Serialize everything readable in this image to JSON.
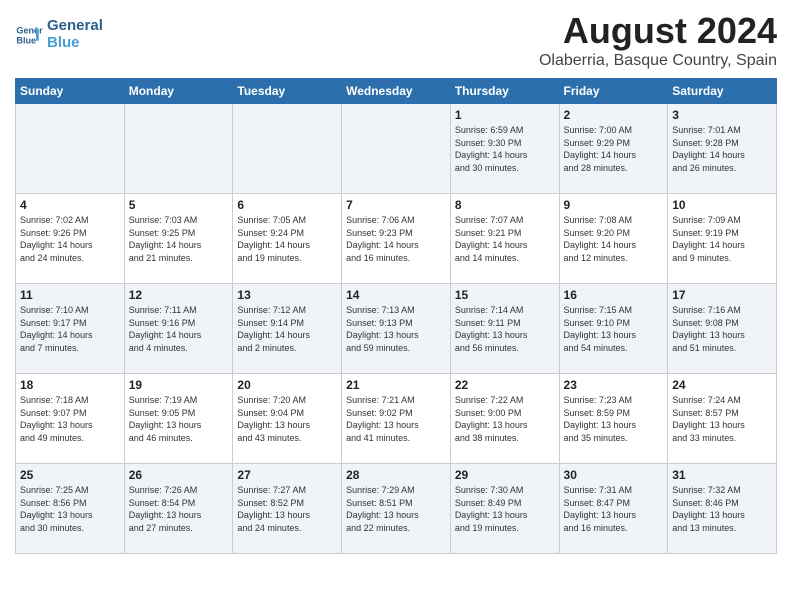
{
  "logo": {
    "line1": "General",
    "line2": "Blue"
  },
  "title": "August 2024",
  "subtitle": "Olaberria, Basque Country, Spain",
  "days_of_week": [
    "Sunday",
    "Monday",
    "Tuesday",
    "Wednesday",
    "Thursday",
    "Friday",
    "Saturday"
  ],
  "weeks": [
    [
      {
        "day": "",
        "info": ""
      },
      {
        "day": "",
        "info": ""
      },
      {
        "day": "",
        "info": ""
      },
      {
        "day": "",
        "info": ""
      },
      {
        "day": "1",
        "info": "Sunrise: 6:59 AM\nSunset: 9:30 PM\nDaylight: 14 hours\nand 30 minutes."
      },
      {
        "day": "2",
        "info": "Sunrise: 7:00 AM\nSunset: 9:29 PM\nDaylight: 14 hours\nand 28 minutes."
      },
      {
        "day": "3",
        "info": "Sunrise: 7:01 AM\nSunset: 9:28 PM\nDaylight: 14 hours\nand 26 minutes."
      }
    ],
    [
      {
        "day": "4",
        "info": "Sunrise: 7:02 AM\nSunset: 9:26 PM\nDaylight: 14 hours\nand 24 minutes."
      },
      {
        "day": "5",
        "info": "Sunrise: 7:03 AM\nSunset: 9:25 PM\nDaylight: 14 hours\nand 21 minutes."
      },
      {
        "day": "6",
        "info": "Sunrise: 7:05 AM\nSunset: 9:24 PM\nDaylight: 14 hours\nand 19 minutes."
      },
      {
        "day": "7",
        "info": "Sunrise: 7:06 AM\nSunset: 9:23 PM\nDaylight: 14 hours\nand 16 minutes."
      },
      {
        "day": "8",
        "info": "Sunrise: 7:07 AM\nSunset: 9:21 PM\nDaylight: 14 hours\nand 14 minutes."
      },
      {
        "day": "9",
        "info": "Sunrise: 7:08 AM\nSunset: 9:20 PM\nDaylight: 14 hours\nand 12 minutes."
      },
      {
        "day": "10",
        "info": "Sunrise: 7:09 AM\nSunset: 9:19 PM\nDaylight: 14 hours\nand 9 minutes."
      }
    ],
    [
      {
        "day": "11",
        "info": "Sunrise: 7:10 AM\nSunset: 9:17 PM\nDaylight: 14 hours\nand 7 minutes."
      },
      {
        "day": "12",
        "info": "Sunrise: 7:11 AM\nSunset: 9:16 PM\nDaylight: 14 hours\nand 4 minutes."
      },
      {
        "day": "13",
        "info": "Sunrise: 7:12 AM\nSunset: 9:14 PM\nDaylight: 14 hours\nand 2 minutes."
      },
      {
        "day": "14",
        "info": "Sunrise: 7:13 AM\nSunset: 9:13 PM\nDaylight: 13 hours\nand 59 minutes."
      },
      {
        "day": "15",
        "info": "Sunrise: 7:14 AM\nSunset: 9:11 PM\nDaylight: 13 hours\nand 56 minutes."
      },
      {
        "day": "16",
        "info": "Sunrise: 7:15 AM\nSunset: 9:10 PM\nDaylight: 13 hours\nand 54 minutes."
      },
      {
        "day": "17",
        "info": "Sunrise: 7:16 AM\nSunset: 9:08 PM\nDaylight: 13 hours\nand 51 minutes."
      }
    ],
    [
      {
        "day": "18",
        "info": "Sunrise: 7:18 AM\nSunset: 9:07 PM\nDaylight: 13 hours\nand 49 minutes."
      },
      {
        "day": "19",
        "info": "Sunrise: 7:19 AM\nSunset: 9:05 PM\nDaylight: 13 hours\nand 46 minutes."
      },
      {
        "day": "20",
        "info": "Sunrise: 7:20 AM\nSunset: 9:04 PM\nDaylight: 13 hours\nand 43 minutes."
      },
      {
        "day": "21",
        "info": "Sunrise: 7:21 AM\nSunset: 9:02 PM\nDaylight: 13 hours\nand 41 minutes."
      },
      {
        "day": "22",
        "info": "Sunrise: 7:22 AM\nSunset: 9:00 PM\nDaylight: 13 hours\nand 38 minutes."
      },
      {
        "day": "23",
        "info": "Sunrise: 7:23 AM\nSunset: 8:59 PM\nDaylight: 13 hours\nand 35 minutes."
      },
      {
        "day": "24",
        "info": "Sunrise: 7:24 AM\nSunset: 8:57 PM\nDaylight: 13 hours\nand 33 minutes."
      }
    ],
    [
      {
        "day": "25",
        "info": "Sunrise: 7:25 AM\nSunset: 8:56 PM\nDaylight: 13 hours\nand 30 minutes."
      },
      {
        "day": "26",
        "info": "Sunrise: 7:26 AM\nSunset: 8:54 PM\nDaylight: 13 hours\nand 27 minutes."
      },
      {
        "day": "27",
        "info": "Sunrise: 7:27 AM\nSunset: 8:52 PM\nDaylight: 13 hours\nand 24 minutes."
      },
      {
        "day": "28",
        "info": "Sunrise: 7:29 AM\nSunset: 8:51 PM\nDaylight: 13 hours\nand 22 minutes."
      },
      {
        "day": "29",
        "info": "Sunrise: 7:30 AM\nSunset: 8:49 PM\nDaylight: 13 hours\nand 19 minutes."
      },
      {
        "day": "30",
        "info": "Sunrise: 7:31 AM\nSunset: 8:47 PM\nDaylight: 13 hours\nand 16 minutes."
      },
      {
        "day": "31",
        "info": "Sunrise: 7:32 AM\nSunset: 8:46 PM\nDaylight: 13 hours\nand 13 minutes."
      }
    ]
  ]
}
